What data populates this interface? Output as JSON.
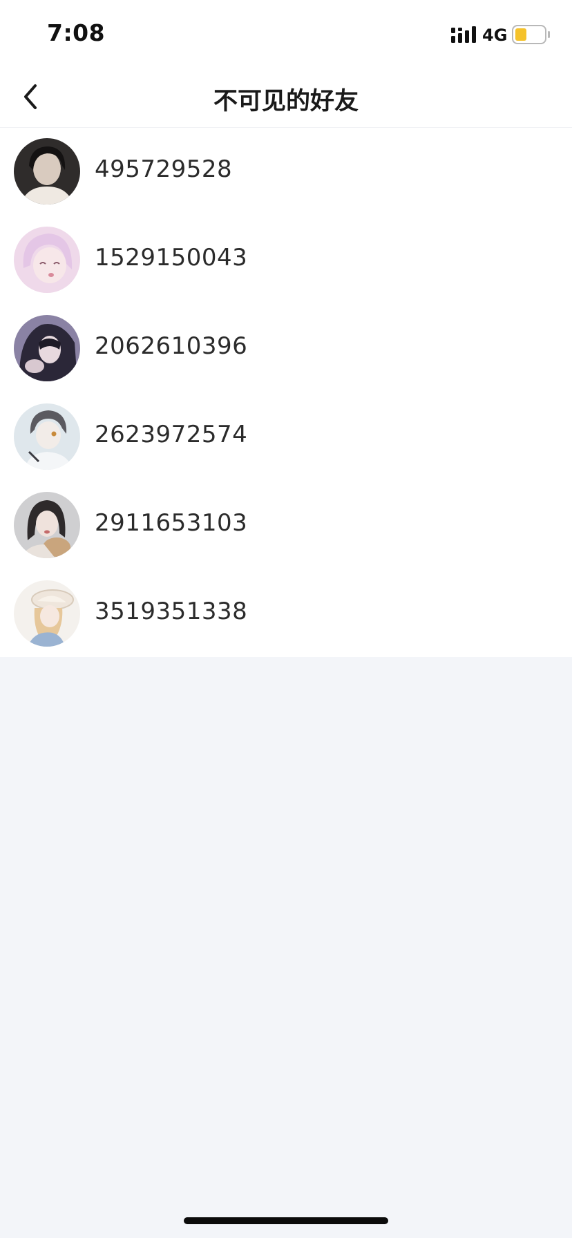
{
  "status_bar": {
    "time": "7:08",
    "network": "4G",
    "battery_fill_fraction": 0.4,
    "battery_color": "#f5c22b",
    "signal_icon": "signal-bars-icon",
    "battery_icon": "battery-icon"
  },
  "nav": {
    "back_icon": "chevron-left-icon",
    "title": "不可见的好友"
  },
  "friends": [
    {
      "name": "495729528"
    },
    {
      "name": "1529150043"
    },
    {
      "name": "2062610396"
    },
    {
      "name": "2623972574"
    },
    {
      "name": "2911653103"
    },
    {
      "name": "3519351338"
    }
  ],
  "colors": {
    "page_background": "#f3f5f9",
    "list_background": "#ffffff",
    "title_text": "#1a1a1a",
    "name_text": "#2b2b2b"
  }
}
